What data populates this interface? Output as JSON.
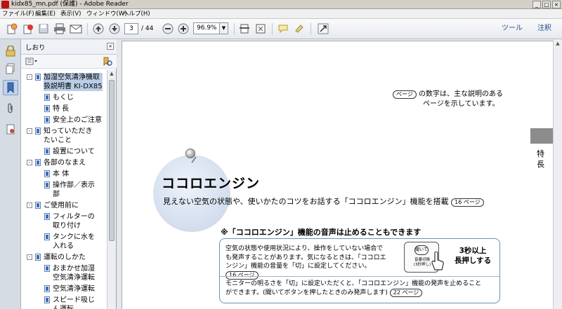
{
  "window": {
    "title": "kidx85_mn.pdf (保護) - Adobe Reader",
    "controls": [
      "_",
      "□",
      "×"
    ]
  },
  "menu": [
    "ファイル(F)",
    "編集(E)",
    "表示(V)",
    "ウィンドウ(W)",
    "ヘルプ(H)"
  ],
  "toolbar": {
    "current_page": "3",
    "total_pages": "/ 44",
    "zoom": "96.9%",
    "tools_link": "ツール",
    "comment_link": "注釈"
  },
  "bookmarks": {
    "panel_title": "しおり",
    "close_glyph": "×",
    "items": [
      {
        "label": "加湿空気清浄機取\n扱説明書 KI-DX85",
        "level": 0,
        "expander": "-",
        "selected": true
      },
      {
        "label": "もくじ",
        "level": 1
      },
      {
        "label": "特 長",
        "level": 1
      },
      {
        "label": "安全上のご注意",
        "level": 1
      },
      {
        "label": "知っていただき\nたいこと",
        "level": 0,
        "expander": "-"
      },
      {
        "label": "設置について",
        "level": 1
      },
      {
        "label": "各部のなまえ",
        "level": 0,
        "expander": "-"
      },
      {
        "label": "本 体",
        "level": 1
      },
      {
        "label": "操作部／表示\n部",
        "level": 1
      },
      {
        "label": "ご使用前に",
        "level": 0,
        "expander": "-"
      },
      {
        "label": "フィルターの\n取り付け",
        "level": 1
      },
      {
        "label": "タンクに水を\n入れる",
        "level": 1
      },
      {
        "label": "運転のしかた",
        "level": 0,
        "expander": "-"
      },
      {
        "label": "おまかせ加湿\n空気清浄運転",
        "level": 1
      },
      {
        "label": "空気清浄運転",
        "level": 1
      },
      {
        "label": "スピード吸じ\nん運転",
        "level": 1
      }
    ]
  },
  "document": {
    "ref_badge": "ページ",
    "ref_note_line1": "の数字は、主な説明のある",
    "ref_note_line2": "ページを示しています。",
    "side_label": "特\n長",
    "heading": "ココロエンジン",
    "subheading": "見えない空気の状態や、使いかたのコツをお話する「ココロエンジン」機能を搭載",
    "subheading_ref": "16 ページ",
    "note_heading": "※「ココロエンジン」機能の音声は止めることもできます",
    "info_p1_a": "空気の状態や使用状況により、操作をしていない場合で",
    "info_p1_b": "も発声することがあります。気になるときは、「ココロエ",
    "info_p1_c": "ンジン」機能の音量を「切」に設定してください。",
    "info_p1_ref": "16 ページ",
    "remote_button": "聞いて",
    "remote_label": "音量切換\n(3秒押し)",
    "press_text": "3秒以上\n長押しする",
    "info_p2_a": "モニターの明るさを「切」に設定いただくと、「ココロエンジン」機能の発声を止めること",
    "info_p2_b": "ができます。(聞いてボタンを押したときのみ発声します)",
    "info_p2_ref": "22 ページ"
  },
  "colors": {
    "selection": "#b9cde6",
    "link": "#1e4f8f",
    "box_border": "#6f8fb8"
  }
}
